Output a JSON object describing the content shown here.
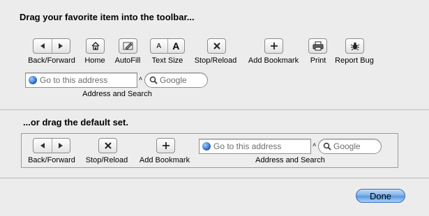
{
  "heading_top": "Drag your favorite item into the toolbar...",
  "heading_default": "...or drag the default set.",
  "items": {
    "back_forward": "Back/Forward",
    "home": "Home",
    "autofill": "AutoFill",
    "text_size": "Text Size",
    "stop_reload": "Stop/Reload",
    "add_bookmark": "Add Bookmark",
    "print": "Print",
    "report_bug": "Report Bug",
    "address_search": "Address and Search"
  },
  "text_size_glyphs": {
    "small": "A",
    "large": "A"
  },
  "address_placeholder": "Go to this address",
  "search_placeholder": "Google",
  "default_set": {
    "back_forward": "Back/Forward",
    "stop_reload": "Stop/Reload",
    "add_bookmark": "Add Bookmark",
    "address_search": "Address and Search"
  },
  "done_label": "Done"
}
